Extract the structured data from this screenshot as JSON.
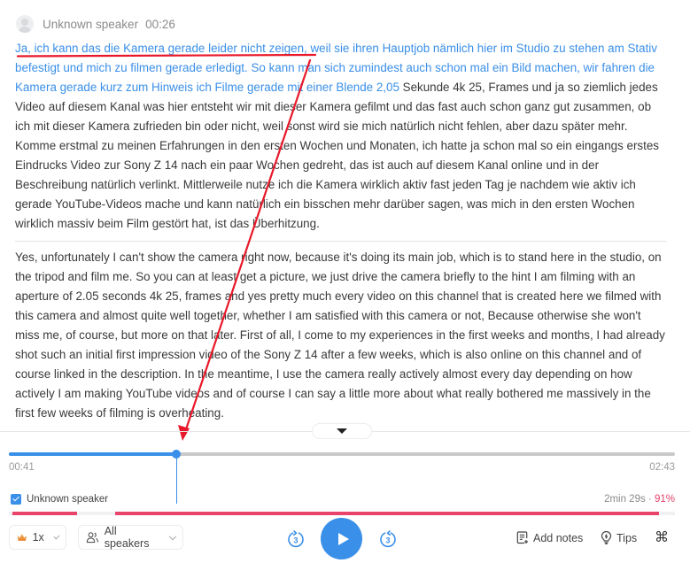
{
  "segment": {
    "speaker": "Unknown speaker",
    "timestamp": "00:26",
    "original_highlighted": "Ja, ich kann das die Kamera gerade leider nicht zeigen, weil sie ihren Hauptjob nämlich hier im Studio zu stehen am Stativ befestigt und mich zu filmen gerade erledigt. So kann man sich zumindest auch schon mal ein Bild machen, wir fahren die Kamera gerade kurz zum Hinweis ich Filme gerade mit einer Blende 2,05",
    "original_rest": " Sekunde 4k 25, Frames und ja so ziemlich jedes Video auf diesem Kanal was hier entsteht wir mit dieser Kamera gefilmt und das fast auch schon ganz gut zusammen, ob ich mit dieser Kamera zufrieden bin oder nicht, weil sonst wird sie mich natürlich nicht fehlen, aber dazu später mehr. Komme erstmal zu meinen Erfahrungen in den ersten Wochen und Monaten, ich hatte ja schon mal so ein eingangs erstes Eindrucks Video zur Sony Z 14 nach ein paar Wochen gedreht, das ist auch auf diesem Kanal online und in der Beschreibung natürlich verlinkt. Mittlerweile nutze ich die Kamera wirklich aktiv fast jeden Tag je nachdem wie aktiv ich gerade YouTube-Videos mache und kann natürlich ein bisschen mehr darüber sagen, was mich in den ersten Wochen wirklich massiv beim Film gestört hat, ist das Überhitzung.",
    "translation": "Yes, unfortunately I can't show the camera right now, because it's doing its main job, which is to stand here in the studio, on the tripod and film me. So you can at least get a picture, we just drive the camera briefly to the hint I am filming with an aperture of 2.05 seconds 4k 25, frames and yes pretty much every video on this channel that is created here we filmed with this camera and almost quite well together, whether I am satisfied with this camera or not, Because otherwise she won't miss me, of course, but more on that later. First of all, I come to my experiences in the first weeks and months, I had already shot such an initial first impression video of the Sony Z 14 after a few weeks, which is also online on this channel and of course linked in the description. In the meantime, I use the camera really actively almost every day depending on how actively I am making YouTube videos and of course I can say a little more about what really bothered me massively in the first few weeks of filming is overheating."
  },
  "collapse_icon": "caret-down-icon",
  "player": {
    "current_time": "00:41",
    "total_time": "02:43",
    "progress_fraction": 0.2515,
    "accent_color": "#3a8fe8"
  },
  "speaker_track": {
    "label": "Unknown speaker",
    "checked": true,
    "duration": "2min 29s",
    "separator": " · ",
    "percent": "91%",
    "color": "#e8436a",
    "segments": [
      {
        "start": 0.005,
        "end": 0.102
      },
      {
        "start": 0.16,
        "end": 0.977
      }
    ]
  },
  "controls": {
    "speed_label": "1x",
    "speakers_filter_label": "All speakers",
    "rewind_seconds": "3",
    "forward_seconds": "3",
    "add_notes_label": "Add notes",
    "tips_label": "Tips",
    "shortcuts_icon": "⌘"
  }
}
